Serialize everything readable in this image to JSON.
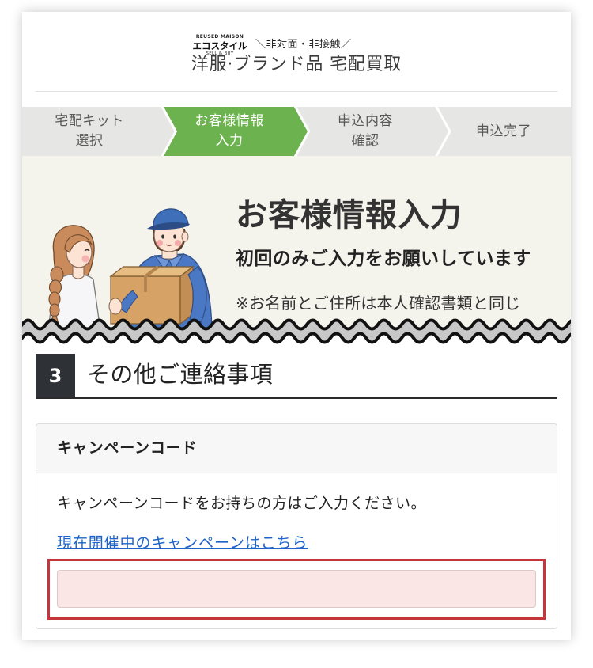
{
  "header": {
    "logo": {
      "top_text": "REUSED MAISON",
      "main_text": "エコスタイル",
      "bottom_text": "SELL & BUY"
    },
    "tagline": "＼非対面・非接触／",
    "title": "洋服·ブランド品 宅配買取"
  },
  "steps": {
    "active_index": 1,
    "items": [
      {
        "line1": "宅配キット",
        "line2": "選択"
      },
      {
        "line1": "お客様情報",
        "line2": "入力"
      },
      {
        "line1": "申込内容",
        "line2": "確認"
      },
      {
        "line1": "申込完了"
      }
    ]
  },
  "banner": {
    "title": "お客様情報入力",
    "subtitle": "初回のみご入力をお願いしています",
    "note": "※お名前とご住所は本人確認書類と同じ"
  },
  "section": {
    "number": "3",
    "title": "その他ご連絡事項"
  },
  "campaign": {
    "header": "キャンペーンコード",
    "description": "キャンペーンコードをお持ちの方はご入力ください。",
    "link_text": "現在開催中のキャンペーンはこちら",
    "input": {
      "value": ""
    }
  },
  "colors": {
    "step_active": "#6cb24e",
    "step_inactive": "#e6e7e5",
    "banner_bg": "#f4f3ec",
    "section_badge": "#2e3236",
    "link": "#1d63c9",
    "highlight_border": "#c5363c",
    "input_bg": "#fbe6e6"
  }
}
